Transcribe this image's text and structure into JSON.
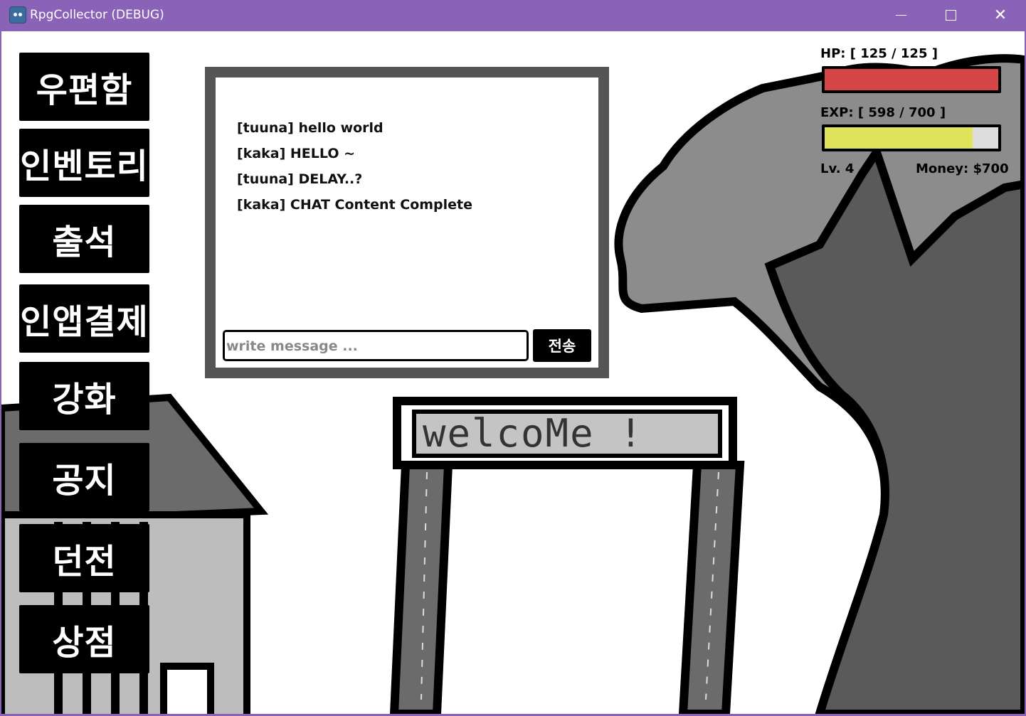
{
  "window": {
    "title": "RpgCollector (DEBUG)"
  },
  "menu": [
    "우편함",
    "인벤토리",
    "출석",
    "인앱결제",
    "강화",
    "공지",
    "던전",
    "상점"
  ],
  "chat": {
    "messages": [
      "[tuuna] hello world",
      "[kaka] HELLO ~",
      "[tuuna] DELAY..?",
      "[kaka] CHAT Content Complete"
    ],
    "input_placeholder": "write message ...",
    "send_label": "전송"
  },
  "stats": {
    "hp_label": "HP: [ 125 / 125 ]",
    "hp_fraction": 1.0,
    "exp_label": "EXP: [ 598 / 700 ]",
    "exp_fraction": 0.854,
    "level": "Lv. 4",
    "money": "Money: $700"
  },
  "scene": {
    "sign_text": "welcoMe !"
  },
  "colors": {
    "titlebar": "#8a63b9",
    "hp": "#d64545",
    "exp": "#e0e35c",
    "tree": "#8c8c8c",
    "trunk": "#5a5a5a"
  }
}
